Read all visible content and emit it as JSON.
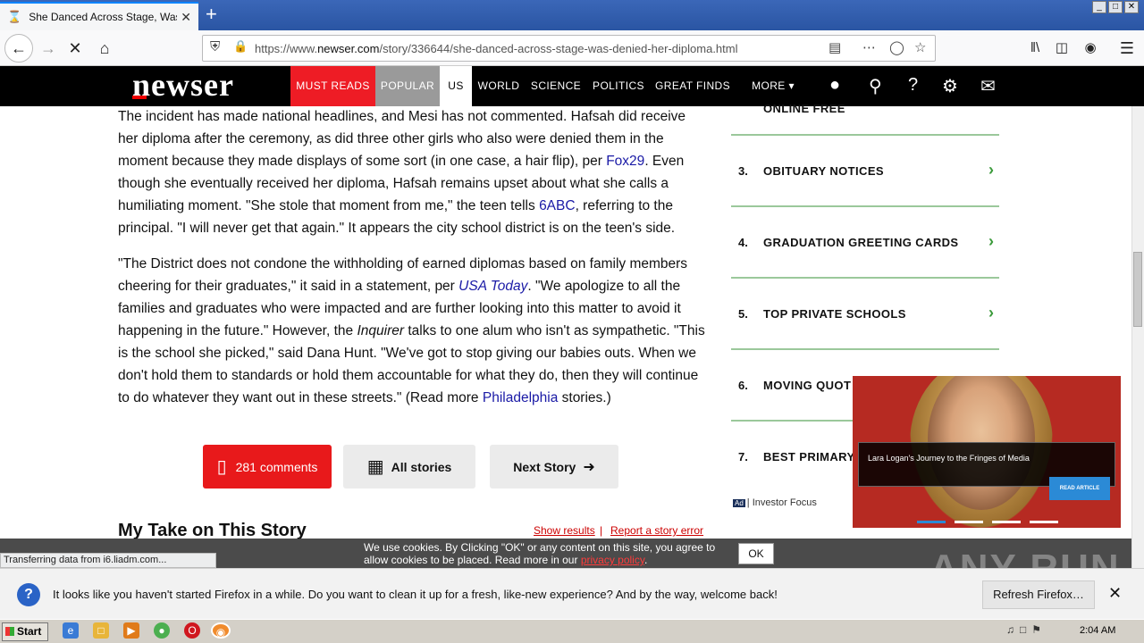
{
  "browser": {
    "tab_title": "She Danced Across Stage, Was De",
    "tab_icon": "hourglass-icon",
    "new_tab": "+",
    "url_prefix": "https://www.",
    "url_domain": "newser.com",
    "url_path": "/story/336644/she-danced-across-stage-was-denied-her-diploma.html",
    "status_text": "Transferring data from i6.liadm.com..."
  },
  "site": {
    "logo": "newser",
    "nav": [
      "MUST READS",
      "POPULAR",
      "US",
      "WORLD",
      "SCIENCE",
      "POLITICS",
      "GREAT FINDS",
      "MORE ▾"
    ],
    "colors": {
      "must_reads_bg": "#ee1c25",
      "popular_bg": "#9a9a9a",
      "us_bg": "#ffffff",
      "header_bg": "#000000"
    }
  },
  "article": {
    "p1": {
      "t1": "The incident has made national headlines, and Mesi has not commented. Hafsah did receive her diploma after the ceremony, as did three other girls who also were denied them in the moment because they made displays of some sort (in one case, a hair flip), per ",
      "l1": "Fox29",
      "t2": ". Even though she eventually received her diploma, Hafsah remains upset about what she calls a humiliating moment. \"She stole that moment from me,\" the teen tells ",
      "l2": "6ABC",
      "t3": ", referring to the principal. \"I will never get that again.\" It appears the city school district is on the teen's side."
    },
    "p2": {
      "t1": "\"The District does not condone the withholding of earned diplomas based on family members cheering for their graduates,\" it said in a statement, per ",
      "l1": "USA Today",
      "t2": ". \"We apologize to all the families and graduates who were impacted and are further looking into this matter to avoid it happening in the future.\" However, the ",
      "i1": "Inquirer",
      "t3": " talks to one alum who isn't as sympathetic. \"This is the school she picked,\" said Dana Hunt. \"We've got to stop giving our babies outs. When we don't hold them to standards or hold them accountable for what they do, then they will continue to do whatever they want out in these streets.\" (Read more ",
      "l2": "Philadelphia",
      "t4": " stories.)"
    },
    "buttons": {
      "comments": "281 comments",
      "all_stories": "All stories",
      "next_story": "Next Story"
    },
    "my_take": "My Take on This Story",
    "show_results": "Show results",
    "separator": "|",
    "report_error": "Report a story error"
  },
  "sidebar": {
    "partial_item": "ONLINE FREE",
    "items": [
      {
        "num": "3.",
        "label": "OBITUARY NOTICES"
      },
      {
        "num": "4.",
        "label": "GRADUATION GREETING CARDS"
      },
      {
        "num": "5.",
        "label": "TOP PRIVATE SCHOOLS"
      },
      {
        "num": "6.",
        "label": "MOVING QUOT"
      },
      {
        "num": "7.",
        "label": "BEST PRIMARY"
      }
    ],
    "ad_badge": "Ad",
    "ad_source": "| Investor Focus"
  },
  "popup": {
    "caption": "Lara Logan's Journey to the Fringes of Media",
    "read_btn": "READ ARTICLE",
    "slides": 4,
    "active_slide": 1
  },
  "cookie": {
    "text": "We use cookies. By Clicking \"OK\" or any content on this site, you agree to allow cookies to be placed. Read more in our ",
    "link": "privacy policy",
    "end": ".",
    "ok": "OK"
  },
  "notification": {
    "message": "It looks like you haven't started Firefox in a while. Do you want to clean it up for a fresh, like-new experience? And by the way, welcome back!",
    "button": "Refresh Firefox…",
    "close": "✕"
  },
  "taskbar": {
    "start": "Start",
    "clock": "2:04 AM"
  },
  "watermark": "ANY RUN"
}
